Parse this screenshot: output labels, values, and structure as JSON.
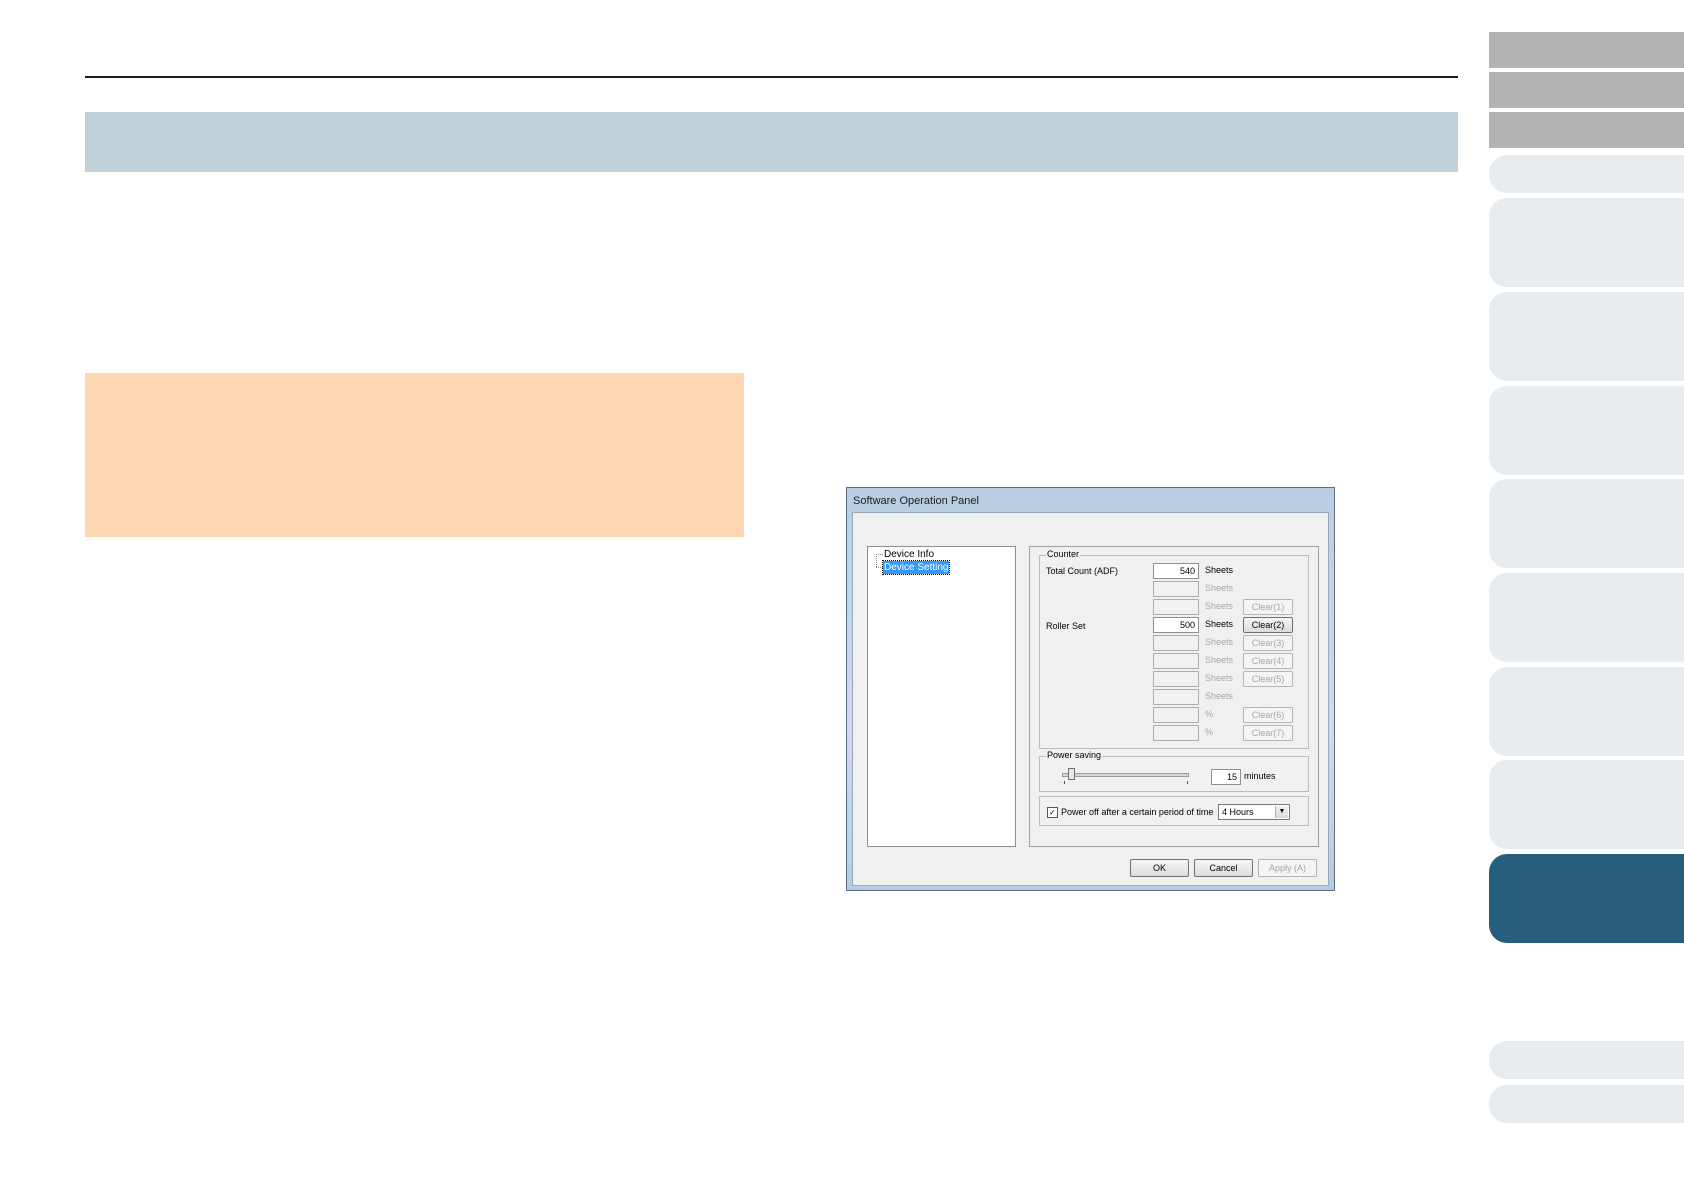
{
  "dialog": {
    "title": "Software Operation Panel",
    "tree": {
      "items": [
        "Device Info",
        "Device Setting"
      ],
      "selected": "Device Setting"
    },
    "counter": {
      "group_label": "Counter",
      "total_count_label": "Total Count (ADF)",
      "total_count_value": "540",
      "roller_set_label": "Roller Set",
      "roller_set_value": "500",
      "unit_sheets": "Sheets",
      "unit_percent": "%",
      "clear_buttons": [
        "Clear(1)",
        "Clear(2)",
        "Clear(3)",
        "Clear(4)",
        "Clear(5)",
        "Clear(6)",
        "Clear(7)"
      ]
    },
    "power_saving": {
      "group_label": "Power saving",
      "value": "15",
      "unit": "minutes",
      "slider_level": 0.05
    },
    "power_off": {
      "label": "Power off after a certain period of time",
      "checked": true,
      "check_mark": "✓",
      "option": "4 Hours"
    },
    "buttons": {
      "ok": "OK",
      "cancel": "Cancel",
      "apply": "Apply (A)"
    }
  },
  "colors": {
    "title_band": "#c0d1da",
    "note_box": "#fcd6b1",
    "tab_gray": "#b3b3b3",
    "tab_light": "#e6ecf0",
    "tab_active": "#275d7d",
    "selection": "#3399ff"
  }
}
